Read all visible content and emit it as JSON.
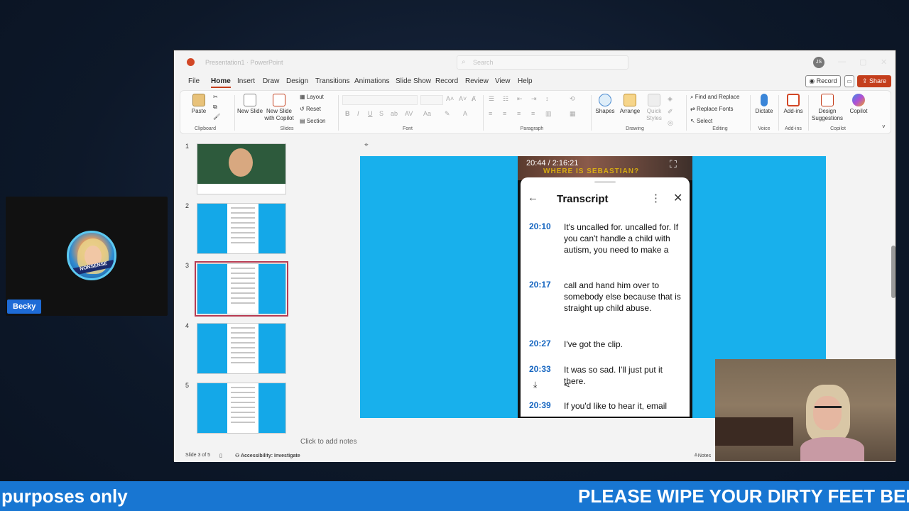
{
  "participant": {
    "name": "Becky",
    "avatar_badge": "NONSENSE"
  },
  "window": {
    "title": "Presentation1 · PowerPoint",
    "search_placeholder": "Search",
    "user_initials": "JS"
  },
  "menu": {
    "tabs": [
      "File",
      "Home",
      "Insert",
      "Draw",
      "Design",
      "Transitions",
      "Animations",
      "Slide Show",
      "Record",
      "Review",
      "View",
      "Help"
    ],
    "record": "Record",
    "share": "Share"
  },
  "ribbon": {
    "paste": "Paste",
    "clipboard": "Clipboard",
    "new_slide": "New Slide",
    "new_slide_copilot": "New Slide with Copilot",
    "layout": "Layout",
    "reset": "Reset",
    "section": "Section",
    "slides": "Slides",
    "font": "Font",
    "paragraph": "Paragraph",
    "shapes": "Shapes",
    "arrange": "Arrange",
    "quick_styles": "Quick Styles",
    "drawing": "Drawing",
    "find_replace": "Find and Replace",
    "replace_fonts": "Replace Fonts",
    "select": "Select",
    "editing": "Editing",
    "dictate": "Dictate",
    "voice": "Voice",
    "add_ins": "Add-ins",
    "add_ins_group": "Add-ins",
    "design_suggestions": "Design Suggestions",
    "copilot": "Copilot",
    "copilot_group": "Copilot"
  },
  "slides": [
    {
      "number": "1"
    },
    {
      "number": "2"
    },
    {
      "number": "3"
    },
    {
      "number": "4"
    },
    {
      "number": "5"
    }
  ],
  "slide": {
    "video_time": "20:44 / 2:16:21",
    "video_caption": "WHERE IS SEBASTIAN?",
    "panel_title": "Transcript",
    "entries": [
      {
        "time": "20:10",
        "text": "It's uncalled for. uncalled for. If you can't handle a child with autism, you need to make a"
      },
      {
        "time": "20:17",
        "text": "call and hand him over to somebody else because that is straight up child abuse."
      },
      {
        "time": "20:27",
        "text": "I've got the clip."
      },
      {
        "time": "20:33",
        "text": "It was so sad. I'll just put it there."
      },
      {
        "time": "20:39",
        "text": "If you'd like to hear it, email"
      }
    ]
  },
  "notes_placeholder": "Click to add notes",
  "status": {
    "slide_counter": "Slide 3 of 5",
    "accessibility": "Accessibility: Investigate",
    "notes": "Notes"
  },
  "ticker": {
    "left_text": "purposes only",
    "right_text": "PLEASE WIPE YOUR DIRTY FEET BEFO"
  },
  "colors": {
    "accent": "#c43e1c",
    "slide_bg": "#18b0ec",
    "ticker_bg": "#1876d2",
    "timestamp": "#1565c0"
  }
}
